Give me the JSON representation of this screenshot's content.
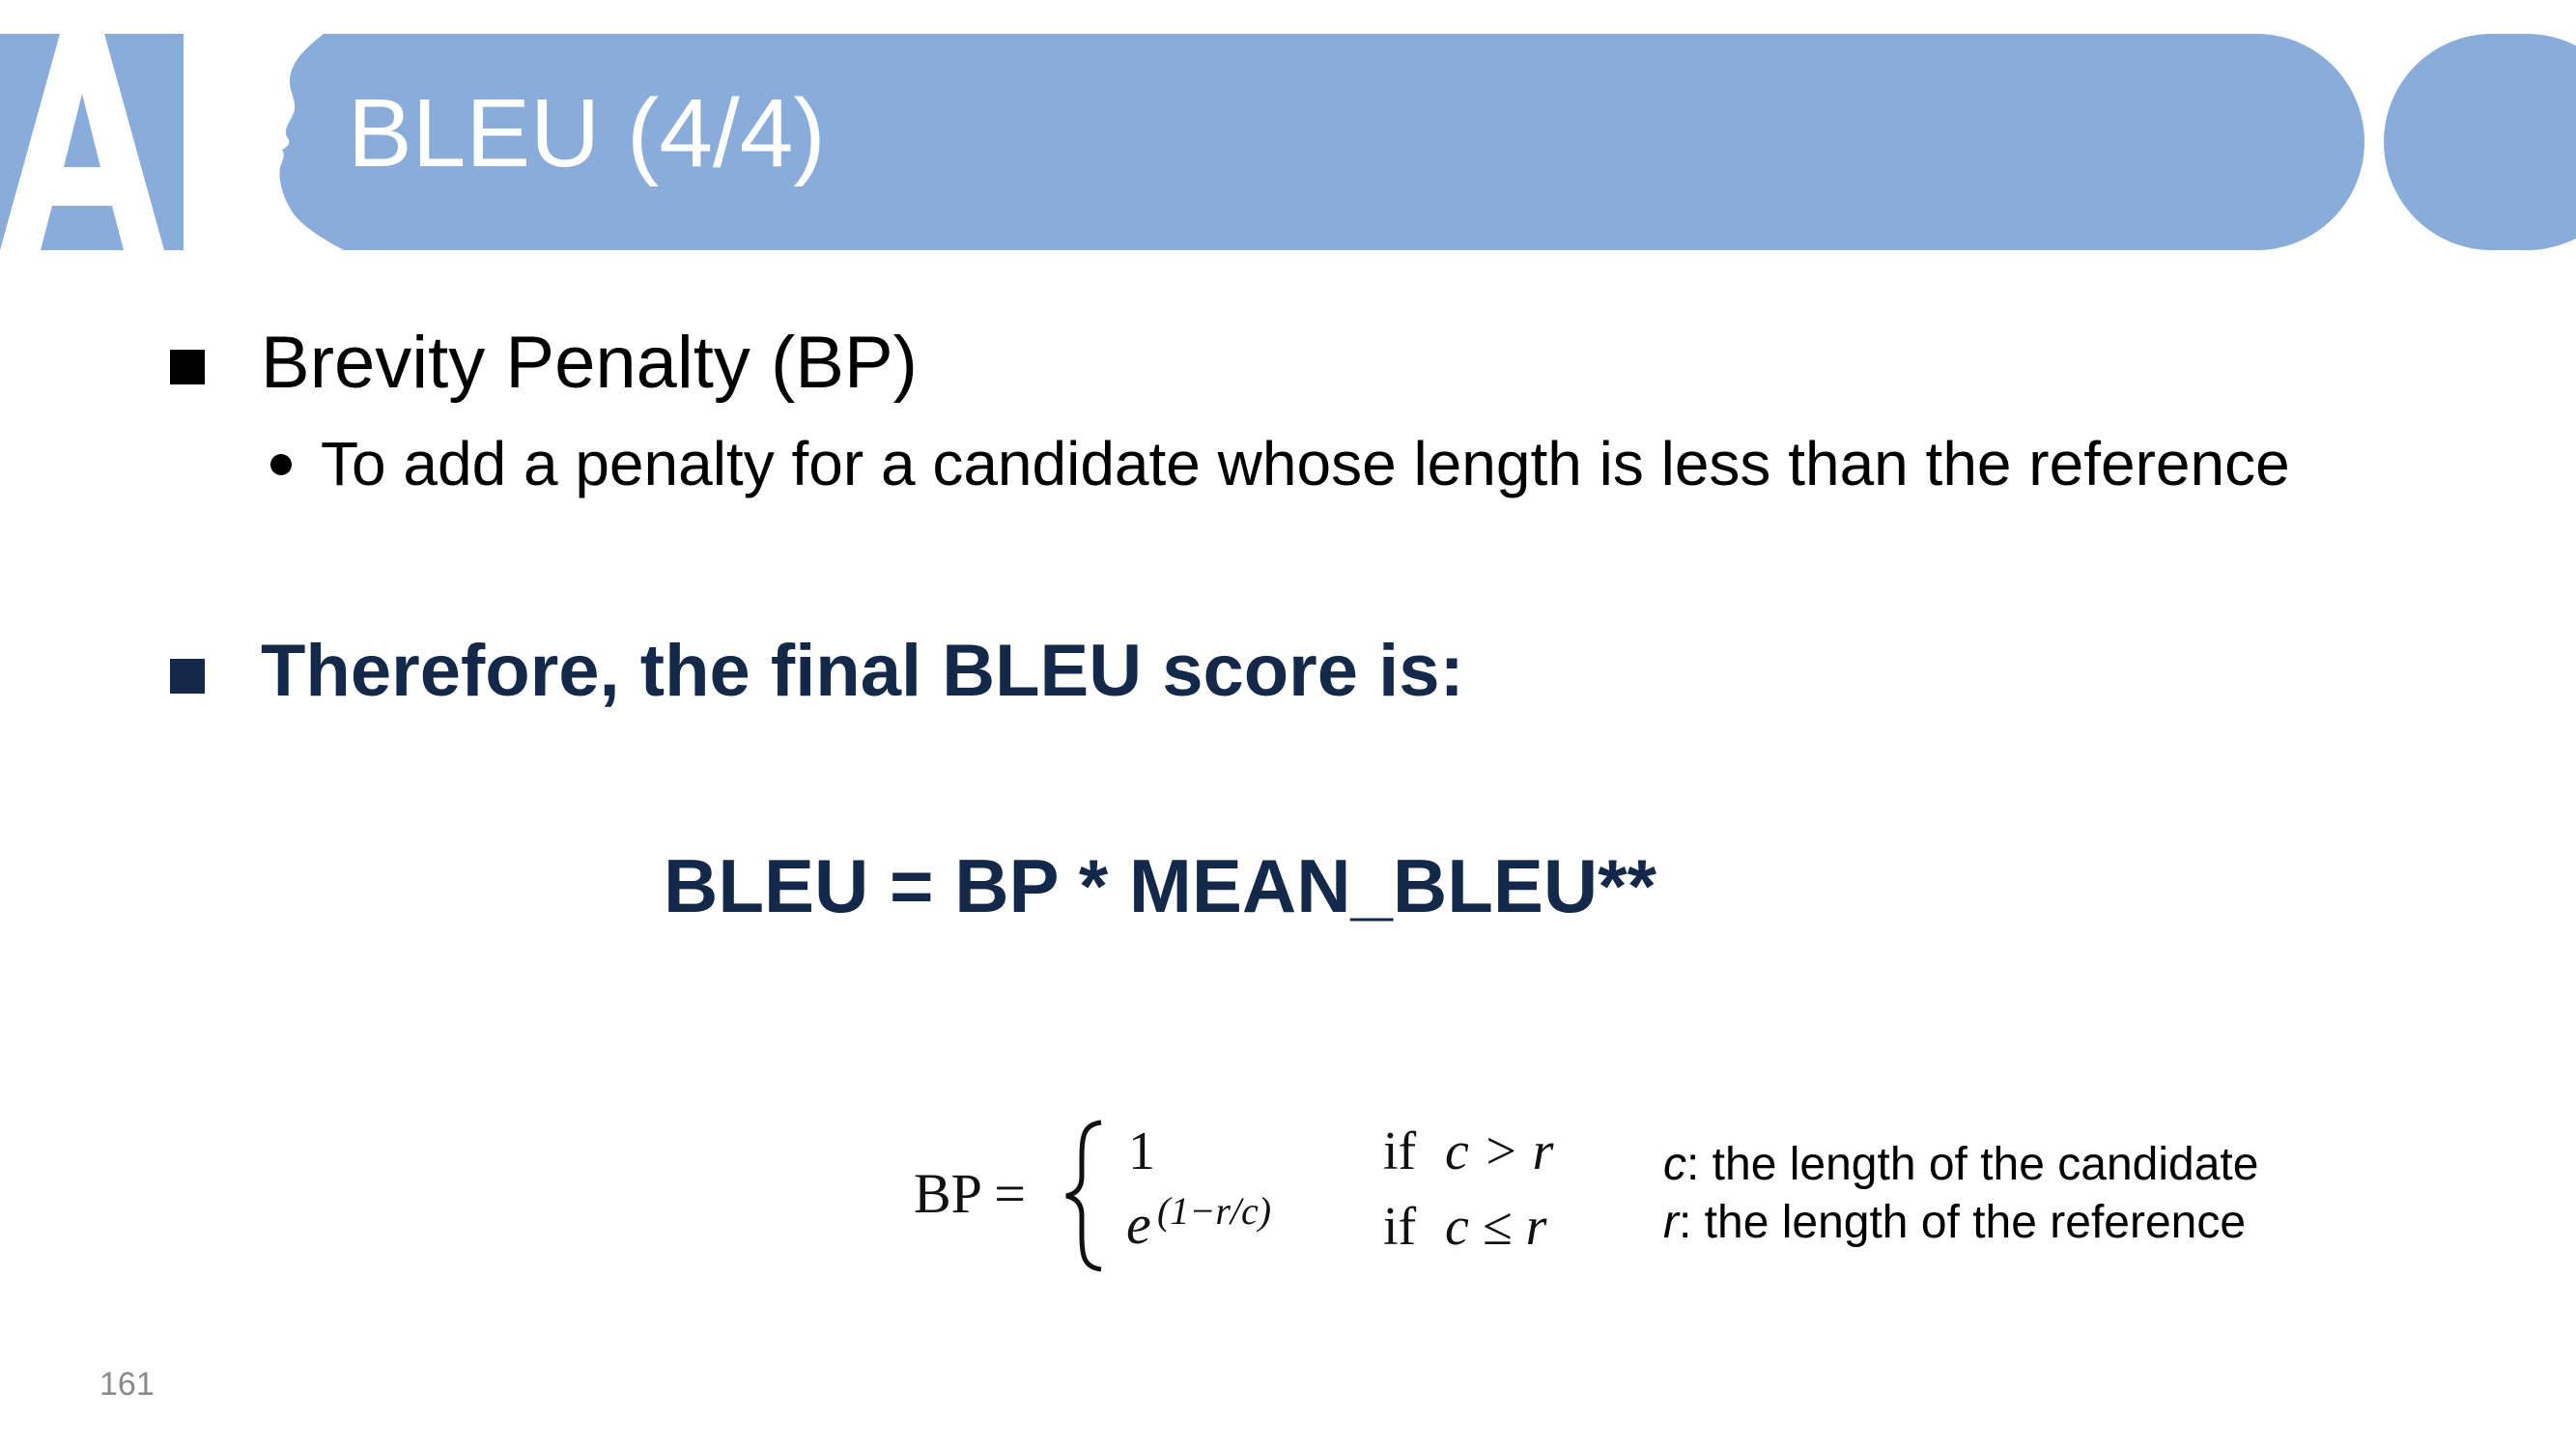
{
  "colors": {
    "header": "#89acdb",
    "bold_text": "#14284a"
  },
  "logo": {
    "text": "AI"
  },
  "header": {
    "title": "BLEU (4/4)"
  },
  "bullets": [
    {
      "text": "Brevity Penalty (BP)",
      "sub": "To add a penalty for a candidate whose length is less than the reference"
    },
    {
      "text": "Therefore, the final BLEU score is:"
    }
  ],
  "formula": "BLEU = BP * MEAN_BLEU**",
  "bp_equation": {
    "lhs": "BP =",
    "case1_value": "1",
    "case1_cond_if": "if",
    "case1_cond": "c > r",
    "case2_base": "e",
    "case2_exp": "(1−r/c)",
    "case2_cond_if": "if",
    "case2_cond": "c ≤ r"
  },
  "notes": [
    {
      "var": "c",
      "text": ": the length of the candidate"
    },
    {
      "var": "r",
      "text": ": the length of the reference"
    }
  ],
  "page_number": "161"
}
